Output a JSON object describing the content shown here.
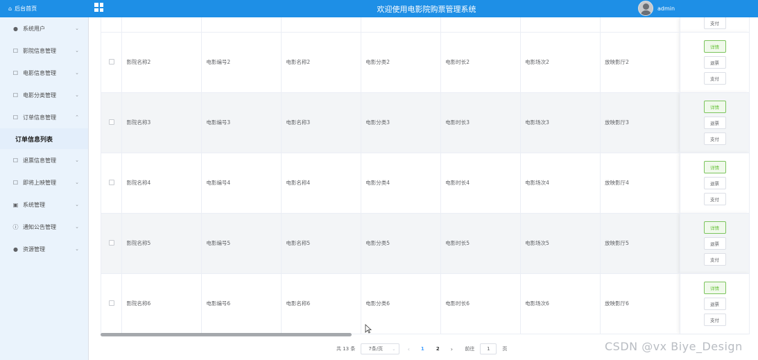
{
  "header": {
    "home_label": "后台首页",
    "title": "欢迎使用电影院购票管理系统",
    "username": "admin"
  },
  "sidebar": {
    "items": [
      {
        "label": "系统用户",
        "icon": "user-icon",
        "expanded": false
      },
      {
        "label": "影院信息管理",
        "icon": "doc-icon",
        "expanded": false
      },
      {
        "label": "电影信息管理",
        "icon": "doc-icon",
        "expanded": false
      },
      {
        "label": "电影分类管理",
        "icon": "doc-icon",
        "expanded": false
      },
      {
        "label": "订单信息管理",
        "icon": "doc-icon",
        "expanded": true
      },
      {
        "label": "订单信息列表",
        "sub": true
      },
      {
        "label": "退票信息管理",
        "icon": "doc-icon",
        "expanded": false
      },
      {
        "label": "即将上映管理",
        "icon": "doc-icon",
        "expanded": false
      },
      {
        "label": "系统管理",
        "icon": "image-icon",
        "expanded": false
      },
      {
        "label": "通知公告管理",
        "icon": "info-icon",
        "expanded": false
      },
      {
        "label": "资源管理",
        "icon": "pin-icon",
        "expanded": false
      }
    ]
  },
  "table": {
    "first_row": {
      "ops": [
        "支付"
      ]
    },
    "rows": [
      {
        "cells": [
          "影院名称2",
          "电影编号2",
          "电影名称2",
          "电影分类2",
          "电影时长2",
          "电影场次2",
          "放映影厅2"
        ],
        "stripe": false
      },
      {
        "cells": [
          "影院名称3",
          "电影编号3",
          "电影名称3",
          "电影分类3",
          "电影时长3",
          "电影场次3",
          "放映影厅3"
        ],
        "stripe": true
      },
      {
        "cells": [
          "影院名称4",
          "电影编号4",
          "电影名称4",
          "电影分类4",
          "电影时长4",
          "电影场次4",
          "放映影厅4"
        ],
        "stripe": false
      },
      {
        "cells": [
          "影院名称5",
          "电影编号5",
          "电影名称5",
          "电影分类5",
          "电影时长5",
          "电影场次5",
          "放映影厅5"
        ],
        "stripe": true
      },
      {
        "cells": [
          "影院名称6",
          "电影编号6",
          "电影名称6",
          "电影分类6",
          "电影时长6",
          "电影场次6",
          "放映影厅6"
        ],
        "stripe": false
      }
    ],
    "ops_labels": {
      "detail": "详情",
      "refund": "退票",
      "pay": "支付"
    }
  },
  "pagination": {
    "total": "共 13 条",
    "page_size": "7条/页",
    "pages": [
      "1",
      "2"
    ],
    "current": "1",
    "prev": "‹",
    "next": "›",
    "goto_label": "前往",
    "goto_value": "1",
    "goto_suffix": "页"
  },
  "watermark": "CSDN @vx  Biye_Design",
  "colors": {
    "header_bg": "#1e8fe6",
    "sidebar_bg": "#eaf3fc",
    "detail_green": "#67c23a",
    "active_page": "#409eff"
  }
}
